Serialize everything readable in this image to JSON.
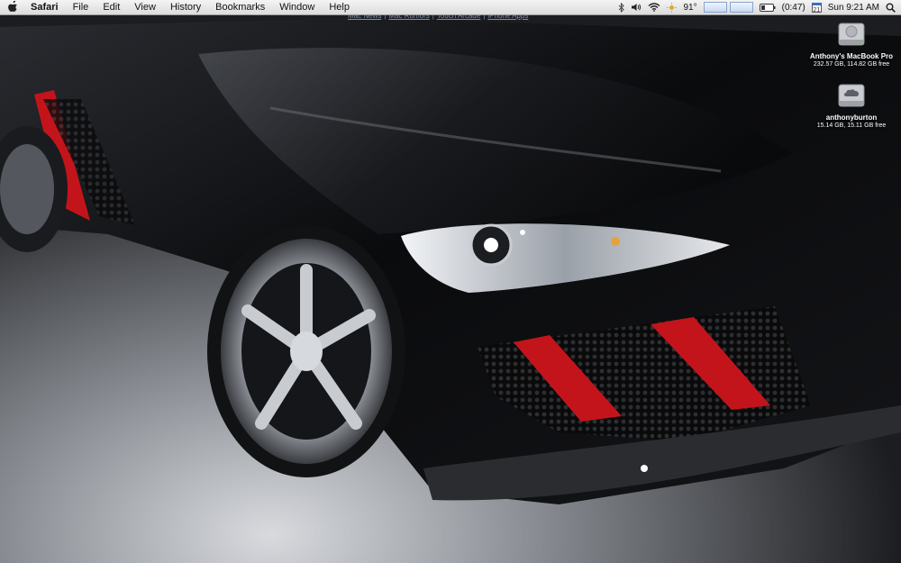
{
  "menubar": {
    "app_name": "Safari",
    "items": [
      "File",
      "Edit",
      "View",
      "History",
      "Bookmarks",
      "Window",
      "Help"
    ],
    "temperature": "91°",
    "battery": "(0:47)",
    "calendar_day": "21",
    "clock": "Sun 9:21 AM"
  },
  "bookmarks": [
    "Mac News",
    "Mac Rumors",
    "Touch Arcade",
    "iPhone Apps"
  ],
  "desktop_icons": [
    {
      "name": "Anthony's MacBook Pro",
      "info": "232.57 GB, 114.82 GB free",
      "icon": "hard-drive-icon"
    },
    {
      "name": "anthonyburton",
      "info": "15.14 GB, 15.11 GB free",
      "icon": "idisk-cloud-icon"
    }
  ],
  "colors": {
    "car_body": "#0d0e10",
    "accent_red": "#c4141b",
    "wheel_silver": "#b8bcc2",
    "floor": "#c9ccd1"
  }
}
